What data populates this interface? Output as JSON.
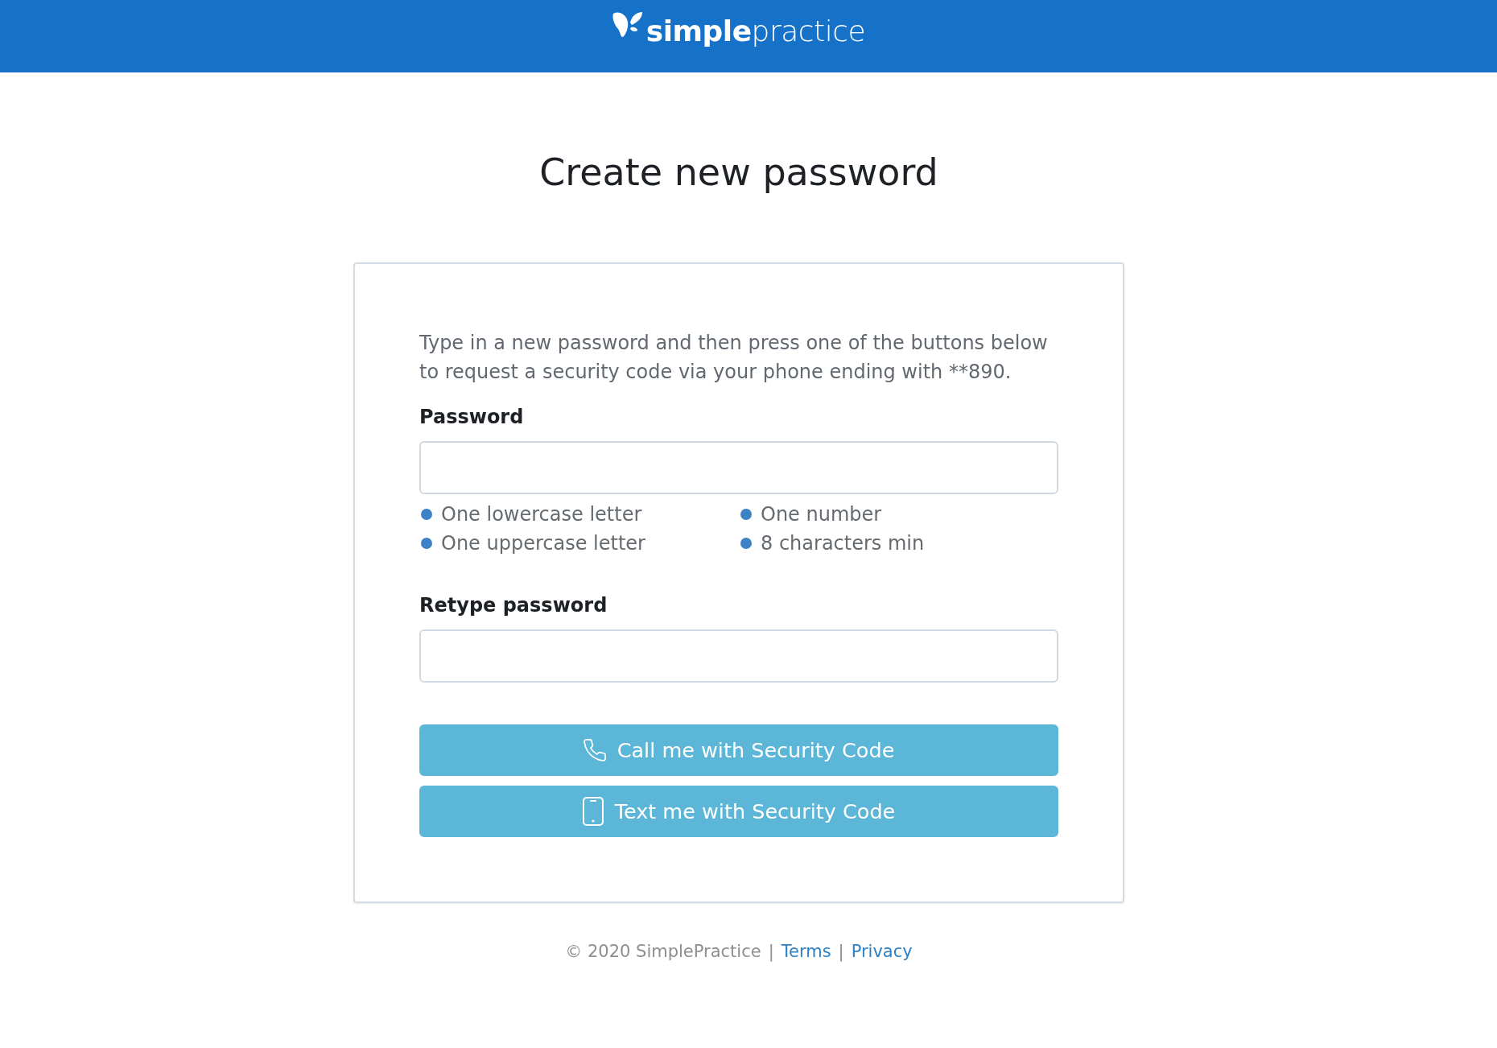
{
  "header": {
    "logo": {
      "bold_part": "simple",
      "light_part": "practice"
    }
  },
  "title": "Create new password",
  "form": {
    "intro": "Type in a new password and then press one of the buttons below to request a security code via your phone ending with **890.",
    "fields": [
      {
        "label": "Password",
        "requirements": [
          "One lowercase letter",
          "One number",
          "One uppercase letter",
          "8 characters min"
        ]
      },
      {
        "label": "Retype password"
      }
    ],
    "buttons": [
      {
        "kind": "call",
        "label": "Call me with Security Code"
      },
      {
        "kind": "sms",
        "label": "Text me with Security Code"
      }
    ]
  },
  "footer": [
    {
      "kind": "text",
      "text": "© 2020 SimplePractice"
    },
    {
      "kind": "separator",
      "text": "|"
    },
    {
      "kind": "link",
      "text": "Terms"
    },
    {
      "kind": "separator",
      "text": "|"
    },
    {
      "kind": "link",
      "text": "Privacy"
    }
  ]
}
